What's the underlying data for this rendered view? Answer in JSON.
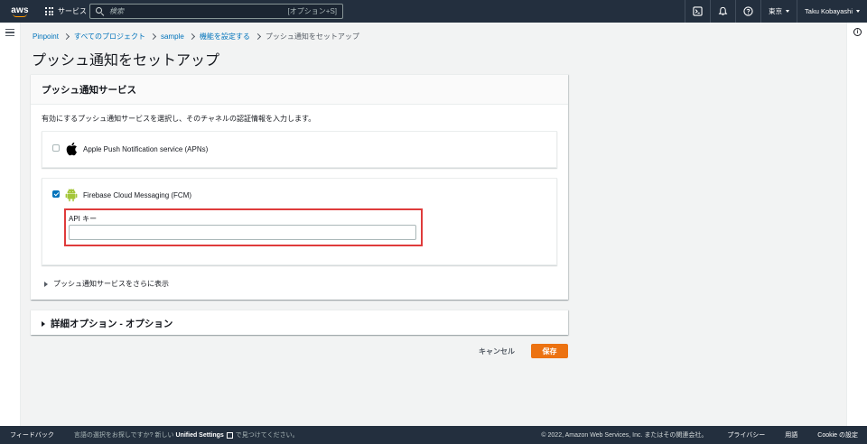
{
  "topnav": {
    "logo_text": "aws",
    "services_label": "サービス",
    "search_placeholder": "検索",
    "search_shortcut": "[オプション+S]",
    "region": "東京",
    "user": "Taku Kobayashi"
  },
  "breadcrumb": [
    "Pinpoint",
    "すべてのプロジェクト",
    "sample",
    "機能を設定する",
    "プッシュ通知をセットアップ"
  ],
  "page_title": "プッシュ通知をセットアップ",
  "panel": {
    "title": "プッシュ通知サービス",
    "description": "有効にするプッシュ通知サービスを選択し、そのチャネルの認証情報を入力します。",
    "providers": [
      {
        "label": "Apple Push Notification service (APNs)",
        "checked": false,
        "icon": "apple-icon"
      },
      {
        "label": "Firebase Cloud Messaging (FCM)",
        "checked": true,
        "icon": "android-icon"
      }
    ],
    "api_key_label": "API キー",
    "api_key_value": "",
    "more_services": "プッシュ通知サービスをさらに表示"
  },
  "advanced": {
    "title": "詳細オプション - オプション"
  },
  "actions": {
    "cancel": "キャンセル",
    "save": "保存"
  },
  "footer": {
    "feedback": "フィードバック",
    "lang_prefix": "言語の選択をお探しですか? 新しい",
    "lang_link": "Unified Settings",
    "lang_suffix": "で見つけてください。",
    "copyright": "© 2022, Amazon Web Services, Inc. またはその関連会社。",
    "privacy": "プライバシー",
    "terms": "用語",
    "cookie": "Cookie の設定"
  },
  "colors": {
    "nav_bg": "#232f3e",
    "link": "#0073bb",
    "primary_button": "#ec7211",
    "highlight_border": "#df3b3b",
    "android_green": "#a4c639"
  }
}
